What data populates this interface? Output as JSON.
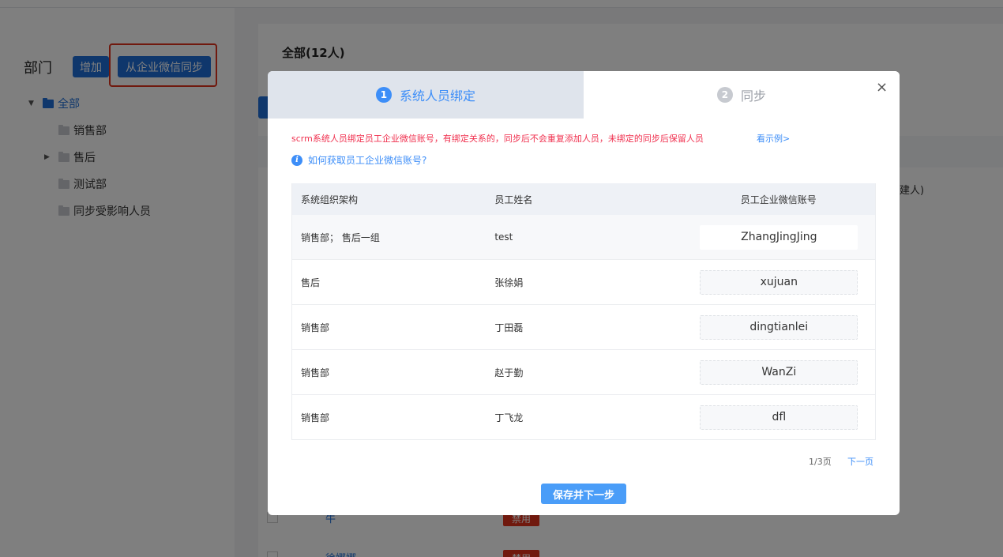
{
  "sidebar": {
    "title": "部门",
    "add_label": "增加",
    "sync_label": "从企业微信同步",
    "tree": {
      "root": "全部",
      "items": [
        "销售部",
        "售后",
        "测试部",
        "同步受影响人员"
      ]
    }
  },
  "main": {
    "title": "全部(12人)",
    "creator_fragment": "建人)",
    "row_names": [
      "牛",
      "徐娜娜"
    ],
    "row_badges": [
      "禁用",
      "禁用"
    ]
  },
  "modal": {
    "steps": [
      {
        "num": "1",
        "label": "系统人员绑定"
      },
      {
        "num": "2",
        "label": "同步"
      }
    ],
    "close_icon": "×",
    "notice": "scrm系统人员绑定员工企业微信账号，有绑定关系的，同步后不会重复添加人员，未绑定的同步后保留人员",
    "example_link": "看示例>",
    "howto_link": "如何获取员工企业微信账号?",
    "table": {
      "headers": [
        "系统组织架构",
        "员工姓名",
        "员工企业微信账号"
      ],
      "rows": [
        {
          "org": "销售部；  售后一组",
          "name": "test",
          "account": "ZhangJingJing"
        },
        {
          "org": "售后",
          "name": "张徐娟",
          "account": "xujuan"
        },
        {
          "org": "销售部",
          "name": "丁田磊",
          "account": "dingtianlei"
        },
        {
          "org": "销售部",
          "name": "赵于勤",
          "account": "WanZi"
        },
        {
          "org": "销售部",
          "name": "丁飞龙",
          "account": "dfl"
        }
      ]
    },
    "pager": {
      "info": "1/3页",
      "next": "下一页"
    },
    "save_label": "保存并下一步"
  }
}
